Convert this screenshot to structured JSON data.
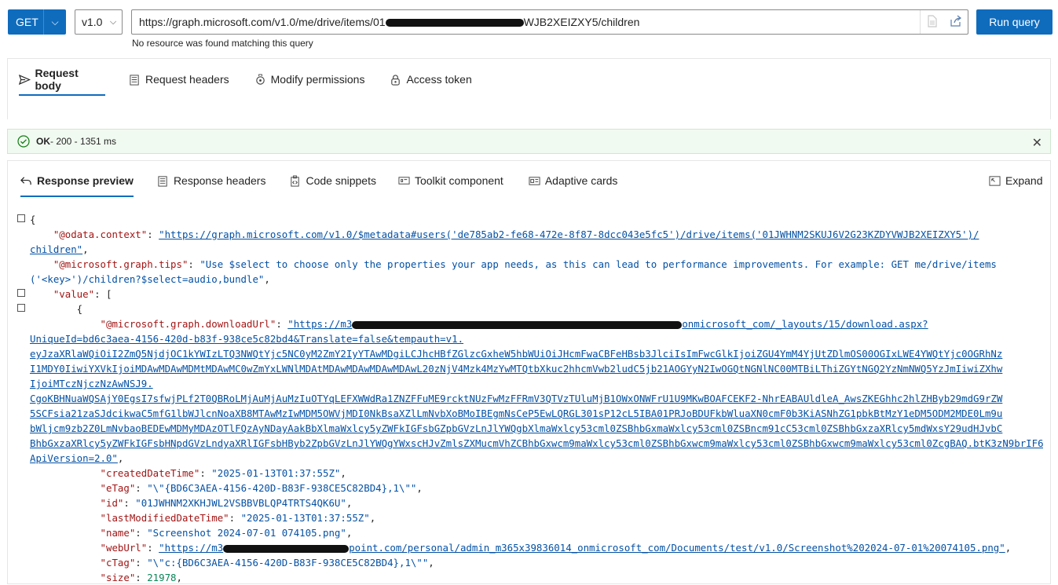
{
  "request": {
    "method": "GET",
    "version": "v1.0",
    "url_prefix": "https://graph.microsoft.com/v1.0/me/drive/items/01",
    "url_suffix": "WJB2XEIZXY5/children",
    "run_label": "Run query",
    "hint": "No resource was found matching this query"
  },
  "request_tabs": [
    "Request body",
    "Request headers",
    "Modify permissions",
    "Access token"
  ],
  "status": {
    "ok": "OK",
    "detail": " - 200 - 1351 ms"
  },
  "response_tabs": [
    "Response preview",
    "Response headers",
    "Code snippets",
    "Toolkit component",
    "Adaptive cards"
  ],
  "expand_label": "Expand",
  "code": {
    "l0": "{",
    "ctx_key": "\"@odata.context\"",
    "ctx_val1": "\"https://graph.microsoft.com/v1.0/$metadata#users('de785ab2-fe68-472e-8f87-8dcc043e5fc5')/drive/items('01JWHNM2SKUJ6V2G23KZDYVWJB2XEIZXY5')/",
    "ctx_val2": "children\"",
    "tips_key": "\"@microsoft.graph.tips\"",
    "tips_val1": "\"Use $select to choose only the properties your app needs, as this can lead to performance improvements. For example: GET me/drive/items",
    "tips_val2": "('<key>')/children?$select=audio,bundle\"",
    "value_key": "\"value\"",
    "dl_key": "\"@microsoft.graph.downloadUrl\"",
    "dl_1a": "\"https://m3",
    "dl_1b": "onmicrosoft_com/_layouts/15/download.aspx?",
    "dl_2": "UniqueId=bd6c3aea-4156-420d-b83f-938ce5c82bd4&Translate=false&tempauth=v1.",
    "dl_3": "eyJzaXRlaWQiOiI2ZmQ5NjdjOC1kYWIzLTQ3NWQtYjc5NC0yM2ZmY2IyYTAwMDgiLCJhcHBfZGlzcGxheW5hbWUiOiJHcmFwaCBFeHBsb3JlciIsImFwcGlkIjoiZGU4YmM4YjUtZDlmOS00OGIxLWE4YWQtYjc0OGRhNz",
    "dl_4": "I1MDY0IiwiYXVkIjoiMDAwMDAwMDMtMDAwMC0wZmYxLWNlMDAtMDAwMDAwMDAwMDAwL20zNjV4Mzk4MzYwMTQtbXkuc2hhcmVwb2ludC5jb21AOGYyN2IwOGQtNGNlNC00MTBiLThiZGYtNGQ2YzNmNWQ5YzJmIiwiZXhw",
    "dl_5": "IjoiMTczNjczNzAwNSJ9.",
    "dl_6": "CgoKBHNuaWQSAjY0EgsI7sfwjPLf2T0QBRoLMjAuMjAuMzIuOTYqLEFXWWdRa1ZNZFFuME9rcktNUzFwMzFFRmV3QTVzTUluMjB1OWxONWFrU1U9MKwBOAFCEKF2-NhrEABAUldleA_AwsZKEGhhc2hlZHByb29mdG9rZW",
    "dl_7": "5SCFsia21zaSJdcikwaC5mfG1lbWJlcnNoaXB8MTAwMzIwMDM5OWVjMDI0NkBsaXZlLmNvbXoBMoIBEgmNsCeP5EwLQRGL301sP12cL5IBA01PRJoBDUFkbWluaXN0cmF0b3KiASNhZG1pbkBtMzY1eDM5ODM2MDE0Lm9u",
    "dl_8": "bWljcm9zb2Z0LmNvbaoBEDEwMDMyMDAzOTlFQzAyNDayAakBbXlmaWxlcy5yZWFkIGFsbGZpbGVzLnJlYWQgbXlmaWxlcy53cml0ZSBhbGxmaWxlcy53cml0ZSBncm91cC53cml0ZSBhbGxzaXRlcy5mdWxsY29udHJvbC",
    "dl_9": "BhbGxzaXRlcy5yZWFkIGFsbHNpdGVzLndyaXRlIGFsbHByb2ZpbGVzLnJlYWQgYWxscHJvZmlsZXMucmVhZCBhbGxwcm9maWxlcy53cml0ZSBhbGxwcm9maWxlcy53cml0ZSBhbGxwcm9maWxlcy53cml0ZcgBAQ.btK3zN9brIF6qqq1mUNQXWqpLtFBXwiA6ot-EhoJBtY&",
    "dl_10": "ApiVersion=2.0\"",
    "created_key": "\"createdDateTime\"",
    "created_val": "\"2025-01-13T01:37:55Z\"",
    "etag_key": "\"eTag\"",
    "etag_val": "\"\\\"{BD6C3AEA-4156-420D-B83F-938CE5C82BD4},1\\\"\"",
    "id_key": "\"id\"",
    "id_val": "\"01JWHNM2XKHJWL2VSBBVBLQP4TRTS4QK6U\"",
    "lm_key": "\"lastModifiedDateTime\"",
    "lm_val": "\"2025-01-13T01:37:55Z\"",
    "name_key": "\"name\"",
    "name_val": "\"Screenshot 2024-07-01 074105.png\"",
    "web_key": "\"webUrl\"",
    "web_a": "\"https://m3",
    "web_b": "point.com/personal/admin_m365x39836014_onmicrosoft_com/Documents/test/v1.0/Screenshot%202024-07-01%20074105.png\"",
    "ctag_key": "\"cTag\"",
    "ctag_val": "\"\\\"c:{BD6C3AEA-4156-420D-B83F-938CE5C82BD4},1\\\"\"",
    "size_key": "\"size\"",
    "size_val": "21978"
  }
}
